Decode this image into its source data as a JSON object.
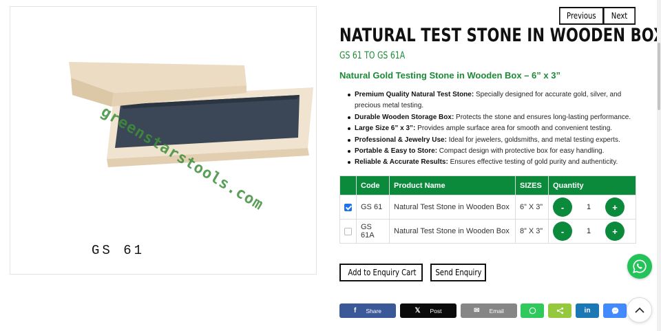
{
  "gallery": {
    "watermark": "greenstarstools.com",
    "image_code": "GS 61"
  },
  "nav": {
    "previous_label": "Previous",
    "next_label": "Next"
  },
  "product": {
    "title": "NATURAL TEST STONE IN WOODEN BOX",
    "subtitle": "GS 61 TO GS 61A",
    "tagline": "Natural Gold Testing Stone in Wooden Box – 6” x 3”"
  },
  "features": [
    {
      "bold": "Premium Quality Natural Test Stone:",
      "text": " Specially designed for accurate gold, silver, and precious metal testing."
    },
    {
      "bold": "Durable Wooden Storage Box:",
      "text": " Protects the stone and ensures long-lasting performance."
    },
    {
      "bold": "Large Size 6” x 3”:",
      "text": " Provides ample surface area for smooth and convenient testing."
    },
    {
      "bold": "Professional & Jewelry Use:",
      "text": " Ideal for jewelers, goldsmiths, and metal testing experts."
    },
    {
      "bold": "Portable & Easy to Store:",
      "text": " Compact design with protective box for easy handling."
    },
    {
      "bold": "Reliable & Accurate Results:",
      "text": " Ensures effective testing of gold purity and authenticity."
    }
  ],
  "table": {
    "headers": {
      "code": "Code",
      "name": "Product Name",
      "sizes": "SIZES",
      "quantity": "Quantity"
    },
    "rows": [
      {
        "checked": true,
        "code": "GS 61",
        "name": "Natural Test Stone in Wooden Box",
        "size": "6” X 3”",
        "qty": "1"
      },
      {
        "checked": false,
        "code": "GS 61A",
        "name": "Natural Test Stone in Wooden Box",
        "size": "8” X 3”",
        "qty": "1"
      }
    ],
    "minus": "-",
    "plus": "+"
  },
  "actions": {
    "add_to_cart": "Add to Enquiry Cart",
    "send_enquiry": "Send Enquiry"
  },
  "share": {
    "facebook": {
      "icon": "f",
      "label": "Share",
      "color": "#3b5998"
    },
    "x": {
      "icon": "𝕏",
      "label": "Post",
      "color": "#0b0b0b"
    },
    "email": {
      "icon": "✉",
      "label": "Email",
      "color": "#868686"
    },
    "whatsapp_color": "#30c95c",
    "sharethis_color": "#95c93d",
    "linkedin": {
      "icon": "in",
      "color": "#1b78b5"
    },
    "messenger_color": "#448aff"
  },
  "colors": {
    "accent_green": "#0a8a3a",
    "subtitle_green": "#1b8a34",
    "whatsapp": "#23c35a"
  }
}
